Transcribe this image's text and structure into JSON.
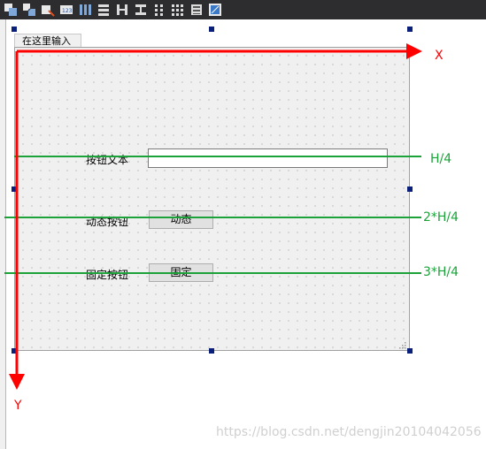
{
  "toolbar": {
    "buttons": [
      {
        "name": "edit-widgets-icon"
      },
      {
        "name": "edit-signals-slots-icon"
      },
      {
        "name": "edit-buddies-icon"
      },
      {
        "name": "edit-tab-order-icon"
      },
      {
        "name": "layout-horizontal-icon"
      },
      {
        "name": "layout-vertical-icon"
      },
      {
        "name": "layout-horizontal-splitter-icon"
      },
      {
        "name": "layout-vertical-splitter-icon"
      },
      {
        "name": "layout-form-icon"
      },
      {
        "name": "layout-grid-icon"
      },
      {
        "name": "break-layout-icon"
      },
      {
        "name": "adjust-size-icon"
      }
    ]
  },
  "form": {
    "menu_placeholder": "在这里输入",
    "rows": [
      {
        "label": "按钮文本"
      },
      {
        "label": "动态按钮",
        "button": "动态"
      },
      {
        "label": "固定按钮",
        "button": "固定"
      }
    ]
  },
  "annotations": {
    "x_axis": "X",
    "y_axis": "Y",
    "guide_lines": [
      "H/4",
      "2*H/4",
      "3*H/4"
    ],
    "axis_color": "#ff0000",
    "guide_color": "#1ba33a"
  },
  "watermark": "https://blog.csdn.net/dengjin20104042056"
}
